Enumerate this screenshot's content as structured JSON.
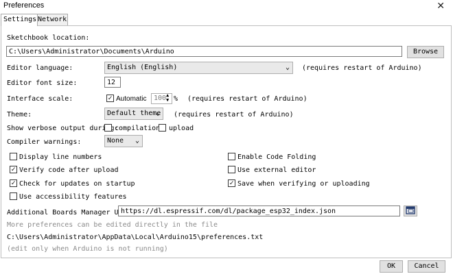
{
  "window": {
    "title": "Preferences",
    "close_glyph": "✕"
  },
  "tabs": [
    {
      "label": "Settings"
    },
    {
      "label": "Network"
    }
  ],
  "sketchbook": {
    "label": "Sketchbook location:",
    "value": "C:\\Users\\Administrator\\Documents\\Arduino",
    "browse_label": "Browse"
  },
  "editor_language": {
    "label": "Editor language:",
    "value": "English (English)",
    "note": "(requires restart of Arduino)"
  },
  "font_size": {
    "label": "Editor font size:",
    "value": "12"
  },
  "interface_scale": {
    "label": "Interface scale:",
    "automatic_label": "Automatic",
    "automatic_checked": true,
    "value": "100",
    "unit": "%",
    "note": "(requires restart of Arduino)"
  },
  "theme": {
    "label": "Theme:",
    "value": "Default theme",
    "note": "(requires restart of Arduino)"
  },
  "verbose": {
    "label": "Show verbose output during:",
    "compilation_label": "compilation",
    "compilation_checked": false,
    "upload_label": "upload",
    "upload_checked": false
  },
  "compiler_warnings": {
    "label": "Compiler warnings:",
    "value": "None"
  },
  "options_left": [
    {
      "label": "Display line numbers",
      "checked": false
    },
    {
      "label": "Verify code after upload",
      "checked": true
    },
    {
      "label": "Check for updates on startup",
      "checked": true
    },
    {
      "label": "Use accessibility features",
      "checked": false
    }
  ],
  "options_right": [
    {
      "label": "Enable Code Folding",
      "checked": false
    },
    {
      "label": "Use external editor",
      "checked": false
    },
    {
      "label": "Save when verifying or uploading",
      "checked": true
    }
  ],
  "boards_manager": {
    "label": "Additional Boards Manager URLs:",
    "value": "https://dl.espressif.com/dl/package_esp32_index.json"
  },
  "footer": {
    "more_prefs": "More preferences can be edited directly in the file",
    "prefs_path": "C:\\Users\\Administrator\\AppData\\Local\\Arduino15\\preferences.txt",
    "edit_note": "(edit only when Arduino is not running)"
  },
  "buttons": {
    "ok": "OK",
    "cancel": "Cancel"
  },
  "check_glyph": "✓"
}
